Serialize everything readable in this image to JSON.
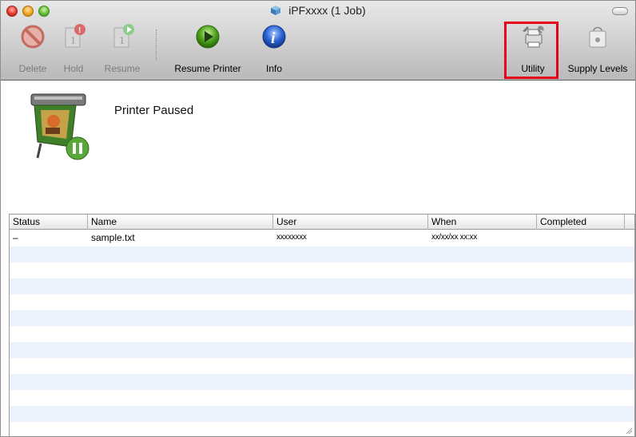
{
  "window": {
    "title": "iPFxxxx (1 Job)",
    "title_icon": "printer-cube-icon",
    "controls": [
      "close",
      "minimize",
      "zoom"
    ]
  },
  "toolbar": {
    "items": [
      {
        "label": "Delete",
        "icon": "delete-icon",
        "enabled": false
      },
      {
        "label": "Hold",
        "icon": "hold-icon",
        "enabled": false
      },
      {
        "label": "Resume",
        "icon": "resume-icon",
        "enabled": false
      },
      {
        "label": "Resume Printer",
        "icon": "resume-printer-icon",
        "enabled": true
      },
      {
        "label": "Info",
        "icon": "info-icon",
        "enabled": true
      },
      {
        "label": "Utility",
        "icon": "utility-icon",
        "enabled": true,
        "highlighted": true
      },
      {
        "label": "Supply Levels",
        "icon": "supply-levels-icon",
        "enabled": true
      }
    ],
    "highlight_color": "#e6001a"
  },
  "status": {
    "text": "Printer Paused",
    "icon": "printer-paused-icon"
  },
  "jobs_table": {
    "columns": [
      "Status",
      "Name",
      "User",
      "When",
      "Completed"
    ],
    "rows": [
      {
        "status": "–",
        "name": "sample.txt",
        "user": "xxxxxxxx",
        "when": "xx/xx/xx xx:xx",
        "completed": ""
      }
    ]
  },
  "colors": {
    "row_stripe": "#edf3fe",
    "toolbar_bg": "#c8c8c8"
  }
}
